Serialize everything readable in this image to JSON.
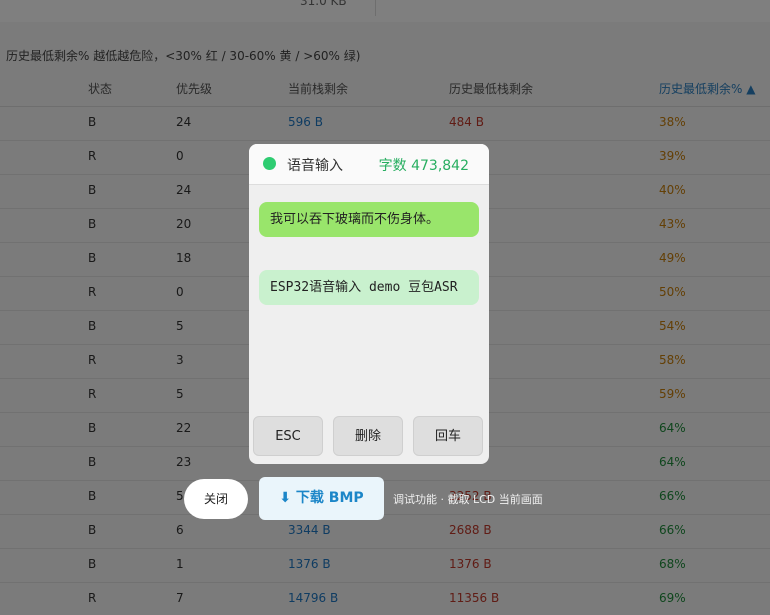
{
  "top": {
    "size_text": "31.0 KB"
  },
  "legend": "历史最低剩余% 越低越危险，<30% 红 / 30-60% 黄 / >60% 绿)",
  "table": {
    "headers": [
      "状态",
      "优先级",
      "当前栈剩余",
      "历史最低栈剩余",
      "历史最低剩余% ▲"
    ],
    "rows": [
      [
        "B",
        "24",
        "596 B",
        "484 B",
        "38%"
      ],
      [
        "R",
        "0",
        "",
        "",
        "39%"
      ],
      [
        "B",
        "24",
        "",
        "",
        "40%"
      ],
      [
        "B",
        "20",
        "",
        "",
        "43%"
      ],
      [
        "B",
        "18",
        "",
        "",
        "49%"
      ],
      [
        "R",
        "0",
        "",
        "",
        "50%"
      ],
      [
        "B",
        "5",
        "",
        "",
        "54%"
      ],
      [
        "R",
        "3",
        "",
        "",
        "58%"
      ],
      [
        "R",
        "5",
        "",
        "",
        "59%"
      ],
      [
        "B",
        "22",
        "",
        "",
        "64%"
      ],
      [
        "B",
        "23",
        "",
        "",
        "64%"
      ],
      [
        "B",
        "5",
        "",
        "3252 B",
        "66%"
      ],
      [
        "B",
        "6",
        "3344 B",
        "2688 B",
        "66%"
      ],
      [
        "B",
        "1",
        "1376 B",
        "1376 B",
        "68%"
      ],
      [
        "R",
        "7",
        "14796 B",
        "11356 B",
        "69%"
      ]
    ]
  },
  "colors": {
    "pct_yellow": "#c87f0a",
    "pct_green": "#1e8c3a"
  },
  "dialog": {
    "title": "语音输入",
    "count": "字数 473,842",
    "main_text": "我可以吞下玻璃而不伤身体。",
    "sub_text": "ESP32语音输入 demo 豆包ASR",
    "keys": {
      "esc": "ESC",
      "delete": "删除",
      "enter": "回车"
    }
  },
  "actions": {
    "close": "关闭",
    "download": "⬇ 下载 BMP",
    "hint": "调试功能 · 截取 LCD 当前画面"
  }
}
